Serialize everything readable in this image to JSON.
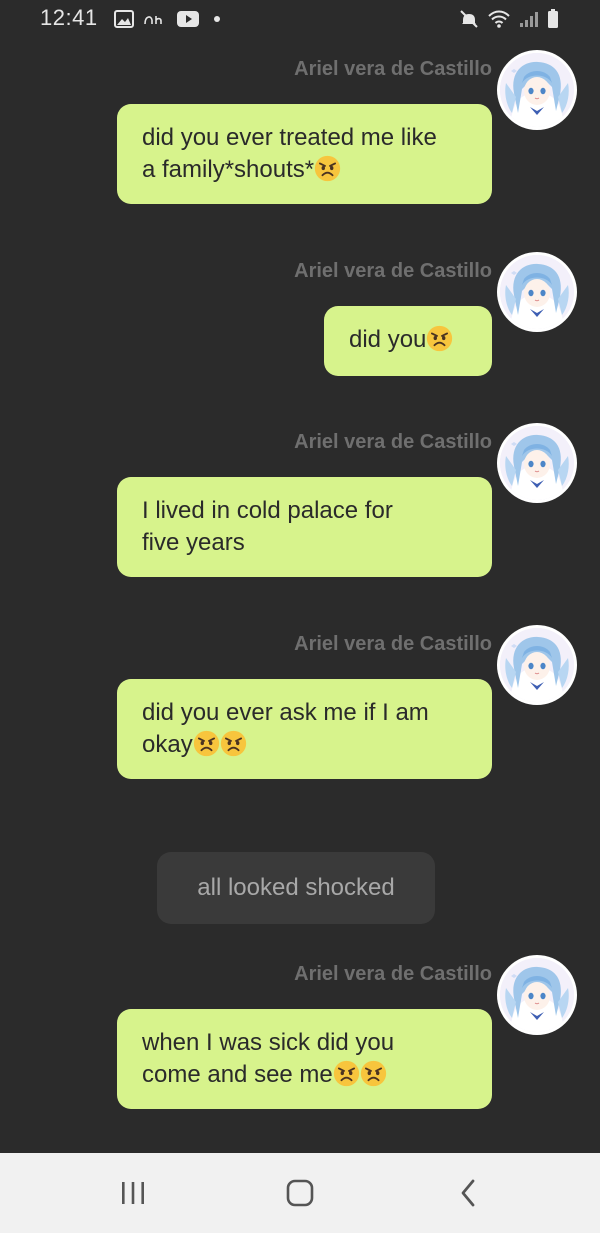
{
  "status_bar": {
    "time": "12:41",
    "icons": [
      "gallery-icon",
      "app-notification-icon",
      "youtube-icon",
      "dot-icon",
      "mute-icon",
      "wifi-icon",
      "signal-icon",
      "battery-icon"
    ]
  },
  "messages": [
    {
      "sender": "Ariel vera de Castillo",
      "lines": [
        "did you ever treated me like",
        "a family*shouts*"
      ],
      "emoji_count": 1
    },
    {
      "sender": "Ariel vera de Castillo",
      "lines": [
        "did you"
      ],
      "emoji_count": 1
    },
    {
      "sender": "Ariel vera de Castillo",
      "lines": [
        "I lived in cold palace for",
        "five years"
      ],
      "emoji_count": 0
    },
    {
      "sender": "Ariel vera de Castillo",
      "lines": [
        "did you ever ask me if I am",
        "okay"
      ],
      "emoji_count": 2
    },
    {
      "sender": "Ariel vera de Castillo",
      "lines": [
        "when I was sick did you",
        "come and see me"
      ],
      "emoji_count": 2
    }
  ],
  "narration": "all looked shocked",
  "emoji": "angry-face-emoji",
  "colors": {
    "background": "#2b2b2b",
    "bubble": "#d7f38c",
    "sender_name": "#6f6f6f",
    "narration_bg": "#3a3a3a",
    "nav_bar": "#f1f1f1"
  },
  "nav_bar": {
    "buttons": [
      "recent-apps-icon",
      "home-icon",
      "back-icon"
    ]
  }
}
